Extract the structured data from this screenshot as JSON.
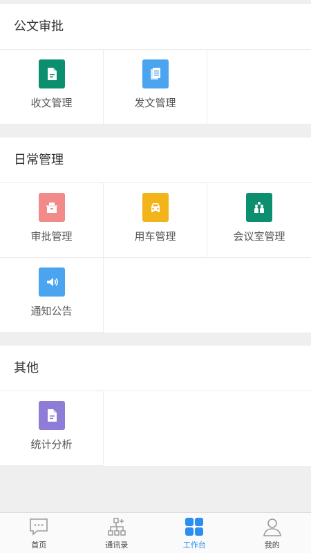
{
  "sections": [
    {
      "title": "公文审批",
      "items": [
        {
          "label": "收文管理",
          "icon": "document-icon",
          "color": "#0b8f6f"
        },
        {
          "label": "发文管理",
          "icon": "pages-icon",
          "color": "#4aa4f0"
        }
      ]
    },
    {
      "title": "日常管理",
      "items": [
        {
          "label": "审批管理",
          "icon": "approval-icon",
          "color": "#f28a8a"
        },
        {
          "label": "用车管理",
          "icon": "car-icon",
          "color": "#f2b418"
        },
        {
          "label": "会议室管理",
          "icon": "meeting-icon",
          "color": "#0b8f6f"
        },
        {
          "label": "通知公告",
          "icon": "speaker-icon",
          "color": "#4aa4f0"
        }
      ]
    },
    {
      "title": "其他",
      "items": [
        {
          "label": "统计分析",
          "icon": "stats-doc-icon",
          "color": "#8e7cd6"
        }
      ]
    }
  ],
  "tabbar": {
    "items": [
      {
        "label": "首页",
        "icon": "chat-bubble-icon",
        "active": false
      },
      {
        "label": "通讯录",
        "icon": "org-chart-icon",
        "active": false
      },
      {
        "label": "工作台",
        "icon": "grid-icon",
        "active": true
      },
      {
        "label": "我的",
        "icon": "person-icon",
        "active": false
      }
    ],
    "active_color": "#2b8ef0"
  }
}
